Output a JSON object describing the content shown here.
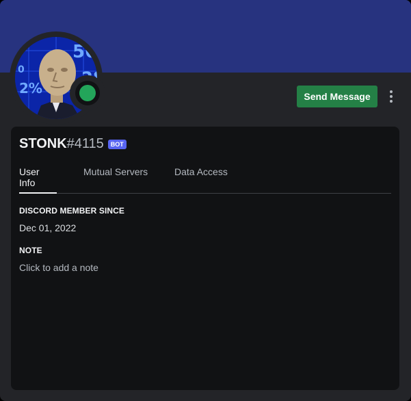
{
  "profile": {
    "username": "STONK",
    "discriminator": "#4115",
    "badge": "BOT",
    "status": "online",
    "avatar_icon": "stonks-meme-avatar",
    "colors": {
      "banner": "#27337f",
      "card": "#232428",
      "panel": "#111214",
      "online": "#23a55a",
      "button": "#248046",
      "bot_badge": "#5865f2"
    }
  },
  "actions": {
    "send_message_label": "Send Message",
    "more_icon": "vertical-ellipsis-icon"
  },
  "tabs": [
    {
      "label": "User Info",
      "active": true
    },
    {
      "label": "Mutual Servers",
      "active": false
    },
    {
      "label": "Data Access",
      "active": false
    }
  ],
  "sections": {
    "member_since_title": "DISCORD MEMBER SINCE",
    "member_since_value": "Dec 01, 2022",
    "note_title": "NOTE",
    "note_placeholder": "Click to add a note"
  }
}
